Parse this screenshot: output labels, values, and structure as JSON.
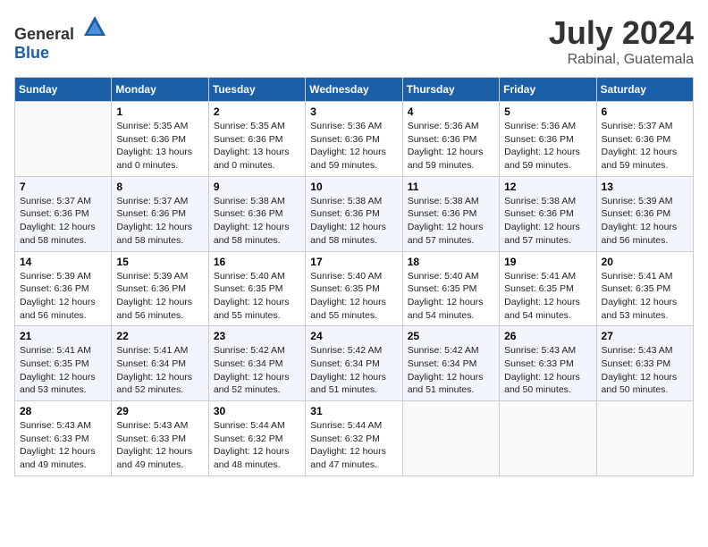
{
  "header": {
    "logo_general": "General",
    "logo_blue": "Blue",
    "month_year": "July 2024",
    "location": "Rabinal, Guatemala"
  },
  "days_of_week": [
    "Sunday",
    "Monday",
    "Tuesday",
    "Wednesday",
    "Thursday",
    "Friday",
    "Saturday"
  ],
  "weeks": [
    [
      {
        "day": "",
        "sunrise": "",
        "sunset": "",
        "daylight": ""
      },
      {
        "day": "1",
        "sunrise": "Sunrise: 5:35 AM",
        "sunset": "Sunset: 6:36 PM",
        "daylight": "Daylight: 13 hours and 0 minutes."
      },
      {
        "day": "2",
        "sunrise": "Sunrise: 5:35 AM",
        "sunset": "Sunset: 6:36 PM",
        "daylight": "Daylight: 13 hours and 0 minutes."
      },
      {
        "day": "3",
        "sunrise": "Sunrise: 5:36 AM",
        "sunset": "Sunset: 6:36 PM",
        "daylight": "Daylight: 12 hours and 59 minutes."
      },
      {
        "day": "4",
        "sunrise": "Sunrise: 5:36 AM",
        "sunset": "Sunset: 6:36 PM",
        "daylight": "Daylight: 12 hours and 59 minutes."
      },
      {
        "day": "5",
        "sunrise": "Sunrise: 5:36 AM",
        "sunset": "Sunset: 6:36 PM",
        "daylight": "Daylight: 12 hours and 59 minutes."
      },
      {
        "day": "6",
        "sunrise": "Sunrise: 5:37 AM",
        "sunset": "Sunset: 6:36 PM",
        "daylight": "Daylight: 12 hours and 59 minutes."
      }
    ],
    [
      {
        "day": "7",
        "sunrise": "Sunrise: 5:37 AM",
        "sunset": "Sunset: 6:36 PM",
        "daylight": "Daylight: 12 hours and 58 minutes."
      },
      {
        "day": "8",
        "sunrise": "Sunrise: 5:37 AM",
        "sunset": "Sunset: 6:36 PM",
        "daylight": "Daylight: 12 hours and 58 minutes."
      },
      {
        "day": "9",
        "sunrise": "Sunrise: 5:38 AM",
        "sunset": "Sunset: 6:36 PM",
        "daylight": "Daylight: 12 hours and 58 minutes."
      },
      {
        "day": "10",
        "sunrise": "Sunrise: 5:38 AM",
        "sunset": "Sunset: 6:36 PM",
        "daylight": "Daylight: 12 hours and 58 minutes."
      },
      {
        "day": "11",
        "sunrise": "Sunrise: 5:38 AM",
        "sunset": "Sunset: 6:36 PM",
        "daylight": "Daylight: 12 hours and 57 minutes."
      },
      {
        "day": "12",
        "sunrise": "Sunrise: 5:38 AM",
        "sunset": "Sunset: 6:36 PM",
        "daylight": "Daylight: 12 hours and 57 minutes."
      },
      {
        "day": "13",
        "sunrise": "Sunrise: 5:39 AM",
        "sunset": "Sunset: 6:36 PM",
        "daylight": "Daylight: 12 hours and 56 minutes."
      }
    ],
    [
      {
        "day": "14",
        "sunrise": "Sunrise: 5:39 AM",
        "sunset": "Sunset: 6:36 PM",
        "daylight": "Daylight: 12 hours and 56 minutes."
      },
      {
        "day": "15",
        "sunrise": "Sunrise: 5:39 AM",
        "sunset": "Sunset: 6:36 PM",
        "daylight": "Daylight: 12 hours and 56 minutes."
      },
      {
        "day": "16",
        "sunrise": "Sunrise: 5:40 AM",
        "sunset": "Sunset: 6:35 PM",
        "daylight": "Daylight: 12 hours and 55 minutes."
      },
      {
        "day": "17",
        "sunrise": "Sunrise: 5:40 AM",
        "sunset": "Sunset: 6:35 PM",
        "daylight": "Daylight: 12 hours and 55 minutes."
      },
      {
        "day": "18",
        "sunrise": "Sunrise: 5:40 AM",
        "sunset": "Sunset: 6:35 PM",
        "daylight": "Daylight: 12 hours and 54 minutes."
      },
      {
        "day": "19",
        "sunrise": "Sunrise: 5:41 AM",
        "sunset": "Sunset: 6:35 PM",
        "daylight": "Daylight: 12 hours and 54 minutes."
      },
      {
        "day": "20",
        "sunrise": "Sunrise: 5:41 AM",
        "sunset": "Sunset: 6:35 PM",
        "daylight": "Daylight: 12 hours and 53 minutes."
      }
    ],
    [
      {
        "day": "21",
        "sunrise": "Sunrise: 5:41 AM",
        "sunset": "Sunset: 6:35 PM",
        "daylight": "Daylight: 12 hours and 53 minutes."
      },
      {
        "day": "22",
        "sunrise": "Sunrise: 5:41 AM",
        "sunset": "Sunset: 6:34 PM",
        "daylight": "Daylight: 12 hours and 52 minutes."
      },
      {
        "day": "23",
        "sunrise": "Sunrise: 5:42 AM",
        "sunset": "Sunset: 6:34 PM",
        "daylight": "Daylight: 12 hours and 52 minutes."
      },
      {
        "day": "24",
        "sunrise": "Sunrise: 5:42 AM",
        "sunset": "Sunset: 6:34 PM",
        "daylight": "Daylight: 12 hours and 51 minutes."
      },
      {
        "day": "25",
        "sunrise": "Sunrise: 5:42 AM",
        "sunset": "Sunset: 6:34 PM",
        "daylight": "Daylight: 12 hours and 51 minutes."
      },
      {
        "day": "26",
        "sunrise": "Sunrise: 5:43 AM",
        "sunset": "Sunset: 6:33 PM",
        "daylight": "Daylight: 12 hours and 50 minutes."
      },
      {
        "day": "27",
        "sunrise": "Sunrise: 5:43 AM",
        "sunset": "Sunset: 6:33 PM",
        "daylight": "Daylight: 12 hours and 50 minutes."
      }
    ],
    [
      {
        "day": "28",
        "sunrise": "Sunrise: 5:43 AM",
        "sunset": "Sunset: 6:33 PM",
        "daylight": "Daylight: 12 hours and 49 minutes."
      },
      {
        "day": "29",
        "sunrise": "Sunrise: 5:43 AM",
        "sunset": "Sunset: 6:33 PM",
        "daylight": "Daylight: 12 hours and 49 minutes."
      },
      {
        "day": "30",
        "sunrise": "Sunrise: 5:44 AM",
        "sunset": "Sunset: 6:32 PM",
        "daylight": "Daylight: 12 hours and 48 minutes."
      },
      {
        "day": "31",
        "sunrise": "Sunrise: 5:44 AM",
        "sunset": "Sunset: 6:32 PM",
        "daylight": "Daylight: 12 hours and 47 minutes."
      },
      {
        "day": "",
        "sunrise": "",
        "sunset": "",
        "daylight": ""
      },
      {
        "day": "",
        "sunrise": "",
        "sunset": "",
        "daylight": ""
      },
      {
        "day": "",
        "sunrise": "",
        "sunset": "",
        "daylight": ""
      }
    ]
  ]
}
